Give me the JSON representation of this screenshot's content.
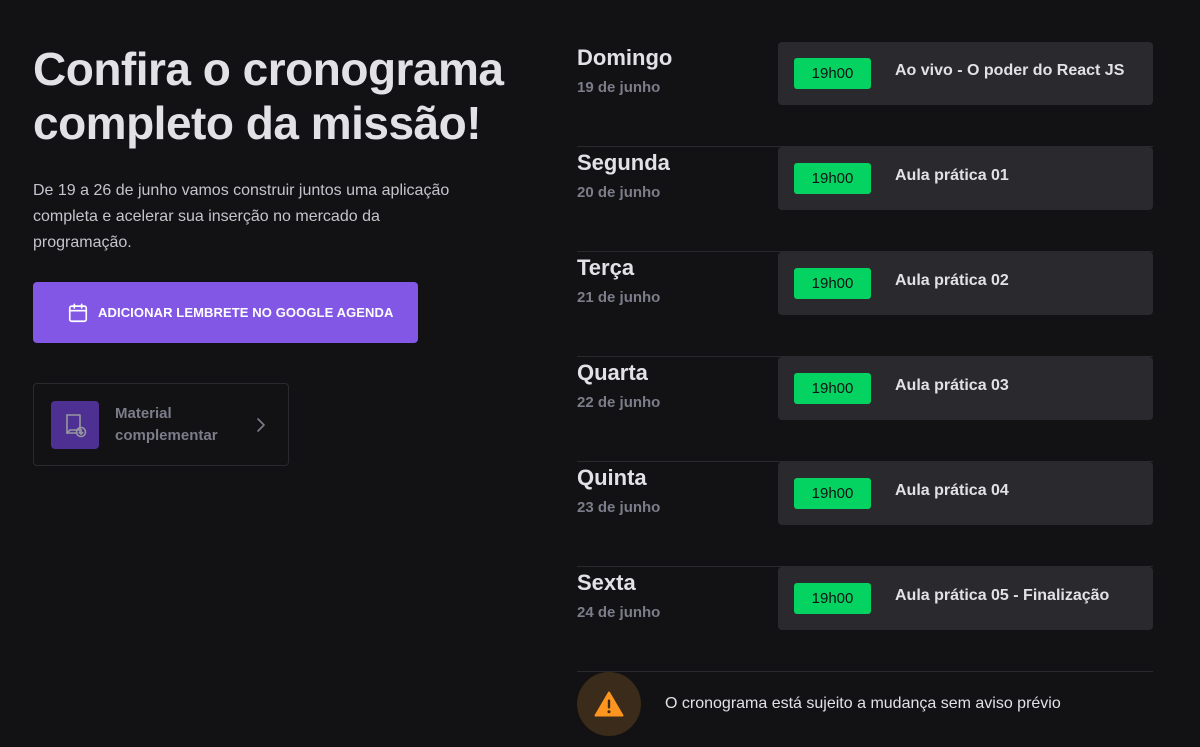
{
  "hero": {
    "title": "Confira o cronograma completo da missão!",
    "description": "De 19 a 26 de junho vamos construir juntos uma aplicação completa e acelerar sua inserção no mercado da programação."
  },
  "reminder_button": {
    "label": "ADICIONAR LEMBRETE NO GOOGLE AGENDA",
    "icon": "calendar-icon"
  },
  "material": {
    "label": "Material complementar",
    "icon": "material-download-icon"
  },
  "schedule": [
    {
      "day": "Domingo",
      "date": "19 de junho",
      "time": "19h00",
      "title": "Ao vivo - O poder do React JS"
    },
    {
      "day": "Segunda",
      "date": "20 de junho",
      "time": "19h00",
      "title": "Aula prática 01"
    },
    {
      "day": "Terça",
      "date": "21 de junho",
      "time": "19h00",
      "title": "Aula prática 02"
    },
    {
      "day": "Quarta",
      "date": "22 de junho",
      "time": "19h00",
      "title": "Aula prática 03"
    },
    {
      "day": "Quinta",
      "date": "23 de junho",
      "time": "19h00",
      "title": "Aula prática 04"
    },
    {
      "day": "Sexta",
      "date": "24 de junho",
      "time": "19h00",
      "title": "Aula prática 05 - Finalização"
    }
  ],
  "notice": {
    "text": "O cronograma está sujeito a mudança sem aviso prévio",
    "icon": "warning-icon"
  },
  "colors": {
    "background": "#121214",
    "accent": "#8257e5",
    "time_badge": "#04d361",
    "card": "#29292e",
    "warning": "#fd951f"
  }
}
